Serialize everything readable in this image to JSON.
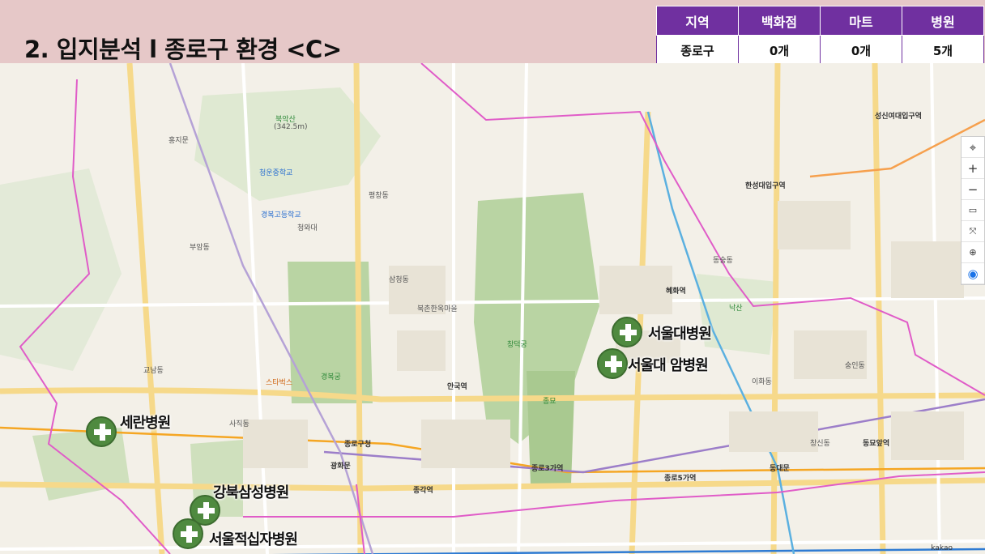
{
  "title": "2. 입지분석 l 종로구 환경 <C>",
  "table": {
    "headers": [
      "지역",
      "백화점",
      "마트",
      "병원"
    ],
    "row": [
      "종로구",
      "0개",
      "0개",
      "5개"
    ]
  },
  "hospitals": [
    {
      "name": "서울대병원"
    },
    {
      "name": "서울대 암병원"
    },
    {
      "name": "세란병원"
    },
    {
      "name": "강북삼성병원"
    },
    {
      "name": "서울적십자병원"
    }
  ],
  "map_labels": {
    "bugaksan": "북악산",
    "bugaksan_h": "(342.5m)",
    "cheongunjung": "청운중학교",
    "gyeongbok_go": "경복고등학교",
    "cheongwadae": "청와대",
    "changdeokgung": "창덕궁",
    "jongmyo": "종묘",
    "gwanghwamun": "광화문",
    "gyeongbokgung": "경복궁",
    "jongno_gu_office": "종로구청",
    "jongno3ga": "종로3가역",
    "jongno5ga": "종로5가역",
    "dongdaemun": "동대문",
    "hyehwa": "혜화역",
    "seongsin": "성신여대입구역",
    "anguk": "안국역",
    "jonggak": "종각역",
    "dongmyo": "동묘앞역",
    "changsin": "창신동",
    "ihwa": "이화동",
    "sungin": "숭인동",
    "bukchon": "북촌한옥마을",
    "naksan": "낙산",
    "starbucks": "스타벅스",
    "samcheong": "삼청동",
    "pyeongchang": "평창동",
    "buam": "부암동",
    "sajik": "사직동",
    "gyonam": "교남동",
    "hoehwa": "홍지문",
    "dongsungdong": "동숭동",
    "hanseong": "한성대입구역",
    "kakao": "kakao"
  },
  "controls": [
    "⌖",
    "+",
    "−",
    "▭",
    "⤧",
    "⊕",
    "◉"
  ]
}
